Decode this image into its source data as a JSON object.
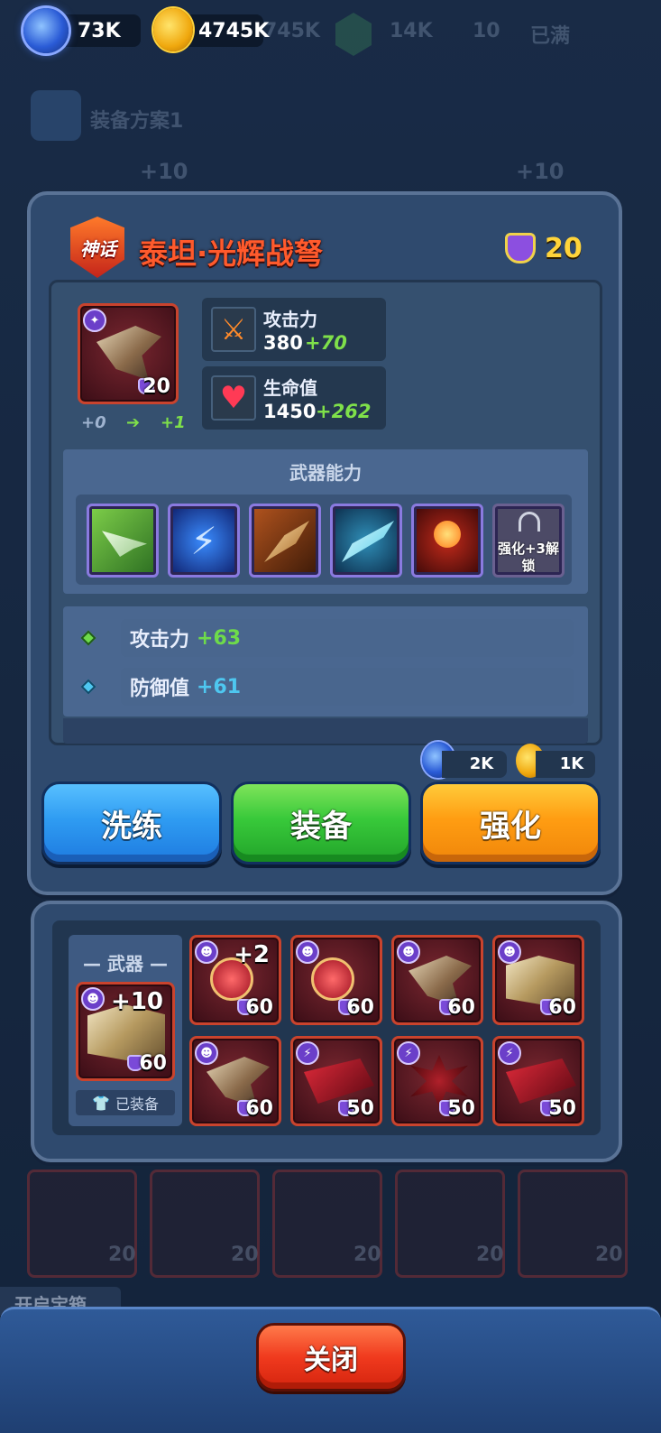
{
  "resources": {
    "gems": "73K",
    "gold": "4745K",
    "bg_value_1": "745K",
    "bg_value_2": "14K",
    "bg_value_3": "10",
    "bg_full": "已满"
  },
  "background": {
    "loadout_title": "装备方案1",
    "upgrade_badge_1": "+10",
    "upgrade_badge_2": "+10",
    "chest_label": "开启宝箱",
    "bottom_levels": [
      "20",
      "20",
      "20",
      "20",
      "20"
    ]
  },
  "item": {
    "rarity_tag": "神话",
    "name": "泰坦·光辉战弩",
    "level": "20",
    "icon_level": "20",
    "refine_from": "+0",
    "refine_to": "+1",
    "stats": [
      {
        "label": "攻击力",
        "base": "380",
        "bonus": "+70"
      },
      {
        "label": "生命值",
        "base": "1450",
        "bonus": "+262"
      }
    ],
    "ability_title": "武器能力",
    "locked_skill_text": "强化+3解锁",
    "sub_stats": [
      {
        "label": "攻击力",
        "value": "+63",
        "color": "#6edb4a"
      },
      {
        "label": "防御值",
        "value": "+61",
        "color": "#4ec7f0"
      }
    ]
  },
  "cost": {
    "gems": "2K",
    "gold": "1K"
  },
  "buttons": {
    "reforge": "洗练",
    "equip": "装备",
    "enhance": "强化",
    "close": "关闭"
  },
  "inventory": {
    "slot_title": "武器",
    "equipped_plus": "+10",
    "equipped_level": "60",
    "equipped_label": "已装备",
    "items": [
      {
        "name": "orb-staff",
        "plus": "+2",
        "level": "60"
      },
      {
        "name": "orb-staff",
        "plus": "",
        "level": "60"
      },
      {
        "name": "crossbow",
        "plus": "",
        "level": "60"
      },
      {
        "name": "spellbook",
        "plus": "",
        "level": "60"
      },
      {
        "name": "crossbow",
        "plus": "",
        "level": "60"
      },
      {
        "name": "red-tome",
        "plus": "",
        "level": "50"
      },
      {
        "name": "spiked-mace",
        "plus": "",
        "level": "50"
      },
      {
        "name": "red-tome",
        "plus": "",
        "level": "50"
      }
    ]
  },
  "colors": {
    "accent_gold": "#ffd43a",
    "bonus_green": "#7fe04a",
    "reforge_blue": "#2f9cf2",
    "equip_green": "#38c93a",
    "enhance_orange": "#ff9d12",
    "close_red": "#f03a1e"
  }
}
